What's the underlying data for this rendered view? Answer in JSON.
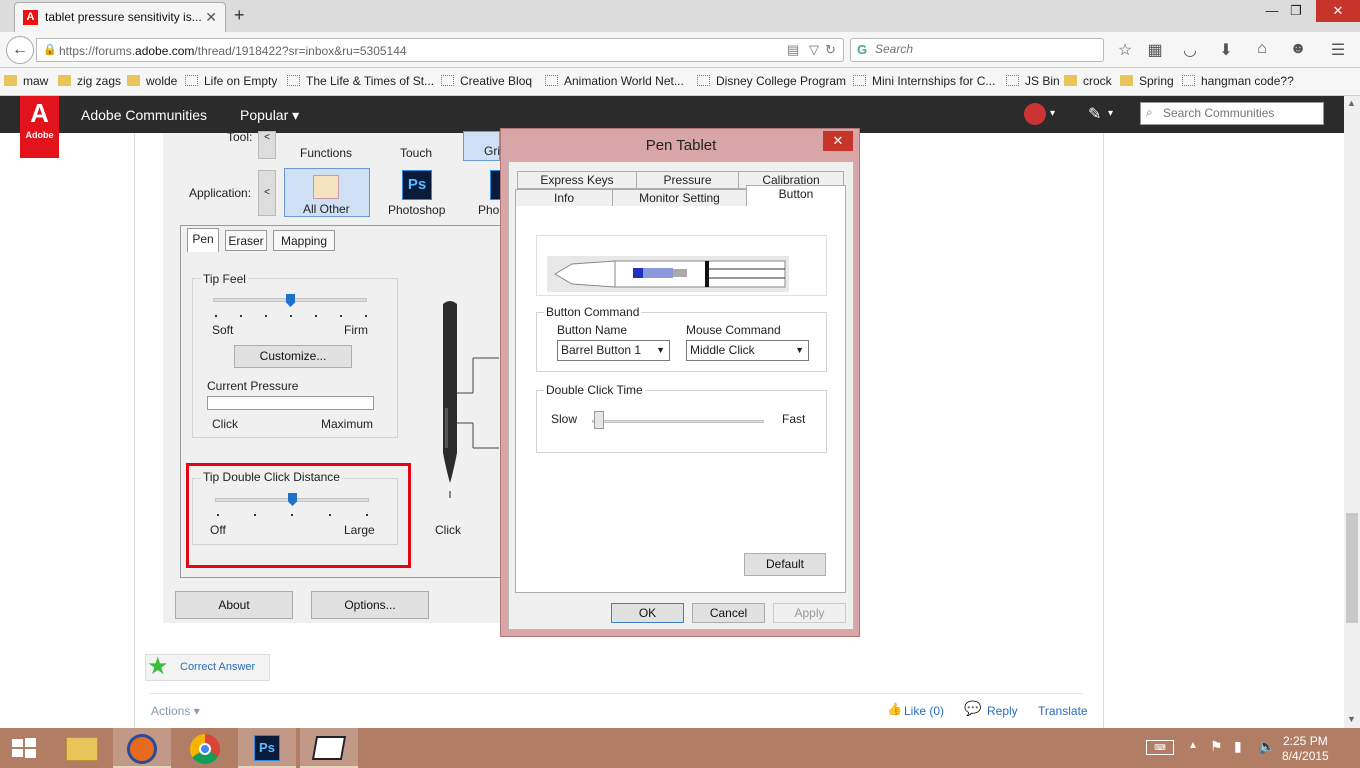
{
  "browser": {
    "tab_title": "tablet pressure sensitivity is...",
    "url_prefix": "https://forums.",
    "url_domain": "adobe.com",
    "url_suffix": "/thread/1918422?sr=inbox&ru=5305144",
    "search_placeholder": "Search",
    "bookmarks": [
      "maw",
      "zig zags",
      "wolde",
      "Life on Empty",
      "The Life & Times of St...",
      "Creative Bloq",
      "Animation World Net...",
      "Disney College Program",
      "Mini Internships for C...",
      "JS Bin",
      "crock",
      "Spring",
      "hangman code??"
    ]
  },
  "adobe": {
    "logo_text": "Adobe",
    "nav_communities": "Adobe Communities",
    "nav_popular": "Popular",
    "search_placeholder": "Search Communities"
  },
  "wacom": {
    "tool_label": "Tool:",
    "tools": [
      "Functions",
      "Touch",
      "Gri"
    ],
    "application_label": "Application:",
    "apps": [
      "All Other",
      "Photoshop",
      "Pho"
    ],
    "tabs": [
      "Pen",
      "Eraser",
      "Mapping"
    ],
    "tip_feel": {
      "title": "Tip Feel",
      "min": "Soft",
      "max": "Firm",
      "level": 0.5
    },
    "customize_button": "Customize...",
    "current_pressure": {
      "title": "Current Pressure",
      "min": "Click",
      "max": "Maximum"
    },
    "tip_double_click": {
      "title": "Tip Double Click Distance",
      "min": "Off",
      "max": "Large",
      "level": 0.5
    },
    "pen_label": "Click",
    "about_button": "About",
    "options_button": "Options..."
  },
  "dialog": {
    "title": "Pen Tablet",
    "tabs_row1": [
      "Express Keys",
      "Pressure",
      "Calibration"
    ],
    "tabs_row2": [
      "Info",
      "Monitor Setting",
      "Button"
    ],
    "button_command": {
      "title": "Button Command",
      "name_label": "Button Name",
      "name_value": "Barrel Button 1",
      "mouse_label": "Mouse Command",
      "mouse_value": "Middle Click"
    },
    "double_click_time": {
      "title": "Double Click Time",
      "min": "Slow",
      "max": "Fast",
      "level": 0.0
    },
    "default_button": "Default",
    "ok_button": "OK",
    "cancel_button": "Cancel",
    "apply_button": "Apply"
  },
  "post": {
    "correct_answer": "Correct Answer",
    "actions": "Actions",
    "like": "Like",
    "like_count": "(0)",
    "reply": "Reply",
    "translate": "Translate"
  },
  "clock": {
    "time": "2:25 PM",
    "date": "8/4/2015"
  },
  "colors": {
    "highlight_box": "#e30613",
    "dialog_frame": "#d8a6a6",
    "adobe_red": "#e3131b",
    "link": "#2a6ebb"
  }
}
